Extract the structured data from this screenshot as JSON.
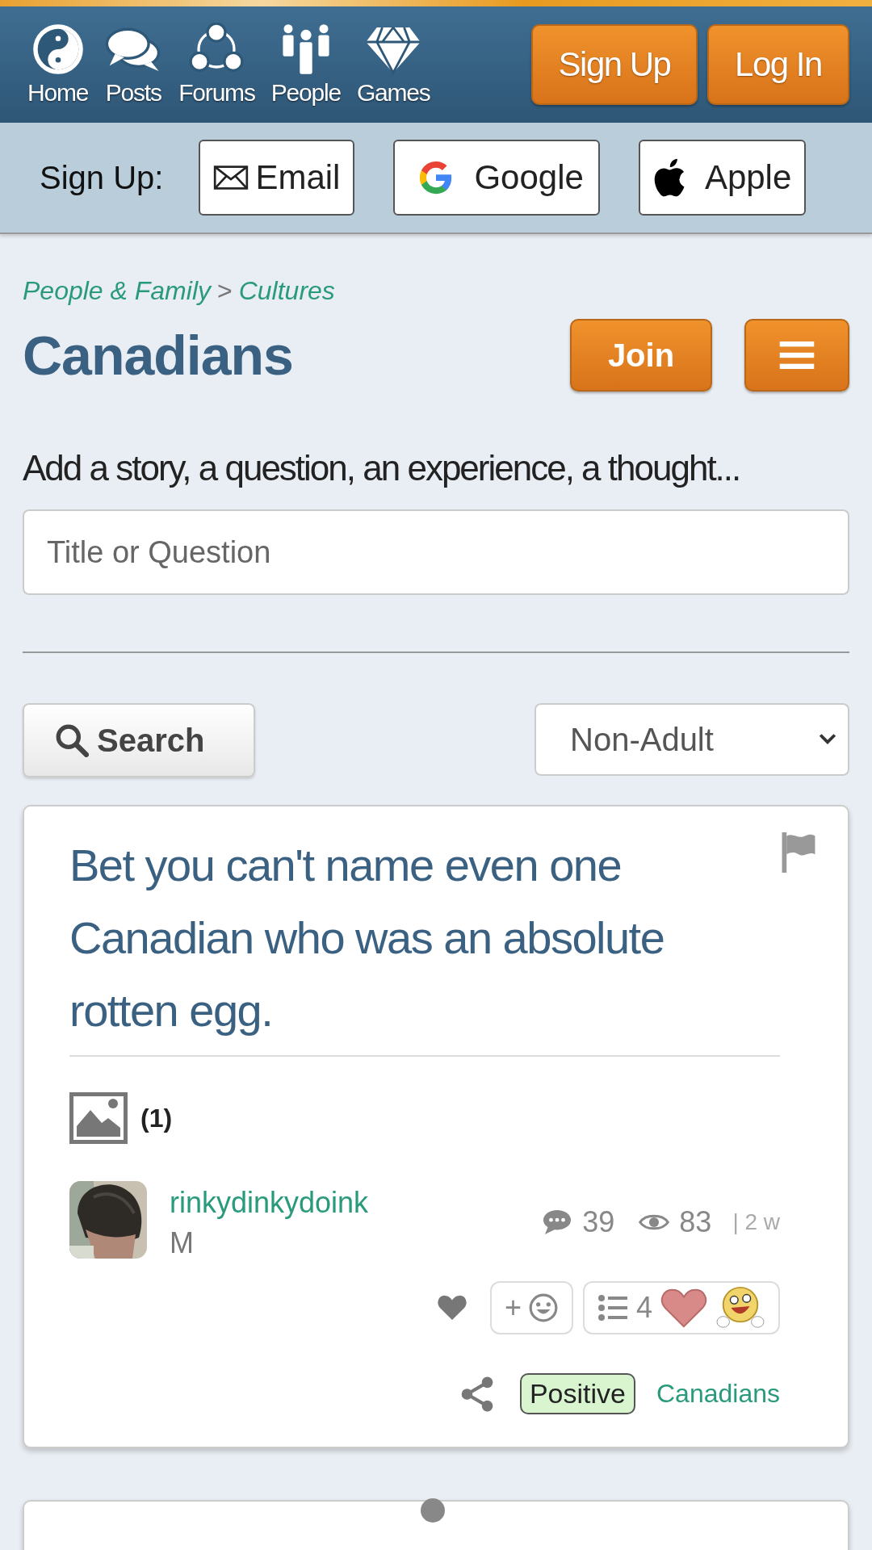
{
  "nav": {
    "items": [
      {
        "label": "Home",
        "kind": "yinyang"
      },
      {
        "label": "Posts",
        "kind": "bubbles"
      },
      {
        "label": "Forums",
        "kind": "circle"
      },
      {
        "label": "People",
        "kind": "people"
      },
      {
        "label": "Games",
        "kind": "diamond"
      }
    ],
    "buttons": [
      "Sign Up",
      "Log In"
    ]
  },
  "signup": {
    "label": "Sign Up:",
    "options": [
      {
        "label": "Email",
        "kind": "email"
      },
      {
        "label": "Google",
        "kind": "google"
      },
      {
        "label": "Apple",
        "kind": "apple"
      }
    ]
  },
  "breadcrumb": {
    "items": [
      "People & Family",
      "Cultures"
    ],
    "separator": ">"
  },
  "group": {
    "title": "Canadians",
    "join": "Join"
  },
  "composer": {
    "prompt": "Add a story, a question, an experience, a thought...",
    "placeholder": "Title or Question"
  },
  "filters": {
    "search": "Search",
    "rating": "Non-Adult"
  },
  "posts": [
    {
      "title": "Bet you can't name even one Canadian who was an absolute rotten egg.",
      "images": "(1)",
      "author": "rinkydinkydoink",
      "gender": "M",
      "comments": "39",
      "views": "83",
      "age": "| 2 w",
      "add_reaction": "+",
      "reaction_count": "4",
      "tag": "Positive",
      "group": "Canadians"
    }
  ]
}
